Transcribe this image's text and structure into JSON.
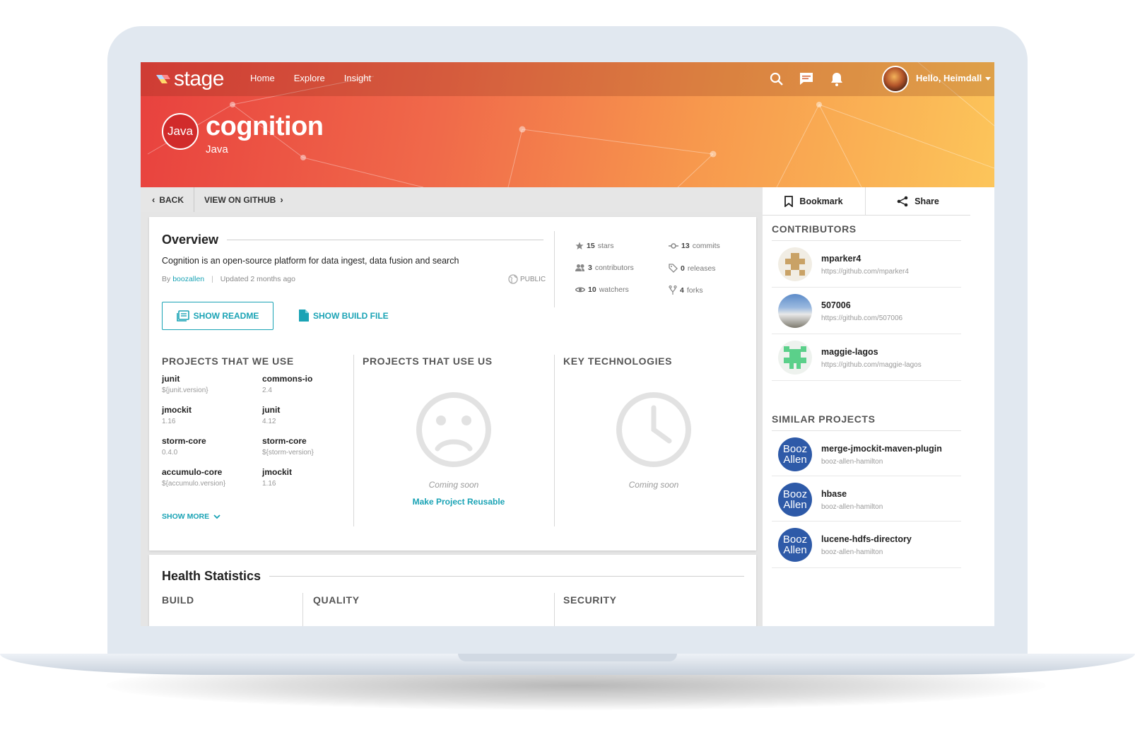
{
  "app": {
    "brand": "stage"
  },
  "nav": {
    "items": [
      "Home",
      "Explore",
      "Insight"
    ]
  },
  "topbar": {
    "greeting": "Hello, Heimdall"
  },
  "project": {
    "language_badge": "Java",
    "name": "cognition",
    "language": "Java"
  },
  "breadcrumbs": {
    "back": "BACK",
    "github": "VIEW ON GITHUB"
  },
  "actions": {
    "bookmark": "Bookmark",
    "share": "Share"
  },
  "overview": {
    "title": "Overview",
    "description": "Cognition is an open-source platform for data ingest, data fusion and search",
    "by": "By",
    "author": "boozallen",
    "updated": "Updated 2 months ago",
    "visibility": "PUBLIC",
    "show_readme": "SHOW README",
    "show_build": "SHOW BUILD FILE"
  },
  "stats": [
    {
      "icon": "star-icon",
      "count": "15",
      "label": "stars"
    },
    {
      "icon": "commit-icon",
      "count": "13",
      "label": "commits"
    },
    {
      "icon": "people-icon",
      "count": "3",
      "label": "contributors"
    },
    {
      "icon": "tag-icon",
      "count": "0",
      "label": "releases"
    },
    {
      "icon": "eye-icon",
      "count": "10",
      "label": "watchers"
    },
    {
      "icon": "fork-icon",
      "count": "4",
      "label": "forks"
    }
  ],
  "projects_we_use": {
    "title": "PROJECTS THAT WE USE",
    "items": [
      {
        "name": "junit",
        "version": "${junit.version}"
      },
      {
        "name": "commons-io",
        "version": "2.4"
      },
      {
        "name": "jmockit",
        "version": "1.16"
      },
      {
        "name": "junit",
        "version": "4.12"
      },
      {
        "name": "storm-core",
        "version": "0.4.0"
      },
      {
        "name": "storm-core",
        "version": "${storm-version}"
      },
      {
        "name": "accumulo-core",
        "version": "${accumulo.version}"
      },
      {
        "name": "jmockit",
        "version": "1.16"
      }
    ],
    "show_more": "SHOW MORE"
  },
  "projects_use_us": {
    "title": "PROJECTS THAT USE US",
    "status": "Coming soon",
    "link": "Make Project Reusable"
  },
  "key_technologies": {
    "title": "KEY TECHNOLOGIES",
    "status": "Coming soon"
  },
  "health": {
    "title": "Health Statistics",
    "columns": [
      "BUILD",
      "QUALITY",
      "SECURITY"
    ]
  },
  "contributors": {
    "title": "CONTRIBUTORS",
    "items": [
      {
        "name": "mparker4",
        "url": "https://github.com/mparker4"
      },
      {
        "name": "507006",
        "url": "https://github.com/507006"
      },
      {
        "name": "maggie-lagos",
        "url": "https://github.com/maggie-lagos"
      }
    ]
  },
  "similar": {
    "title": "SIMILAR PROJECTS",
    "avatar_text": "Booz Allen",
    "items": [
      {
        "name": "merge-jmockit-maven-plugin",
        "org": "booz-allen-hamilton"
      },
      {
        "name": "hbase",
        "org": "booz-allen-hamilton"
      },
      {
        "name": "lucene-hdfs-directory",
        "org": "booz-allen-hamilton"
      }
    ]
  },
  "colors": {
    "accent": "#1aa3b5",
    "hero_start": "#e8413e",
    "hero_end": "#fcc55a",
    "booz": "#2e5aa8"
  }
}
